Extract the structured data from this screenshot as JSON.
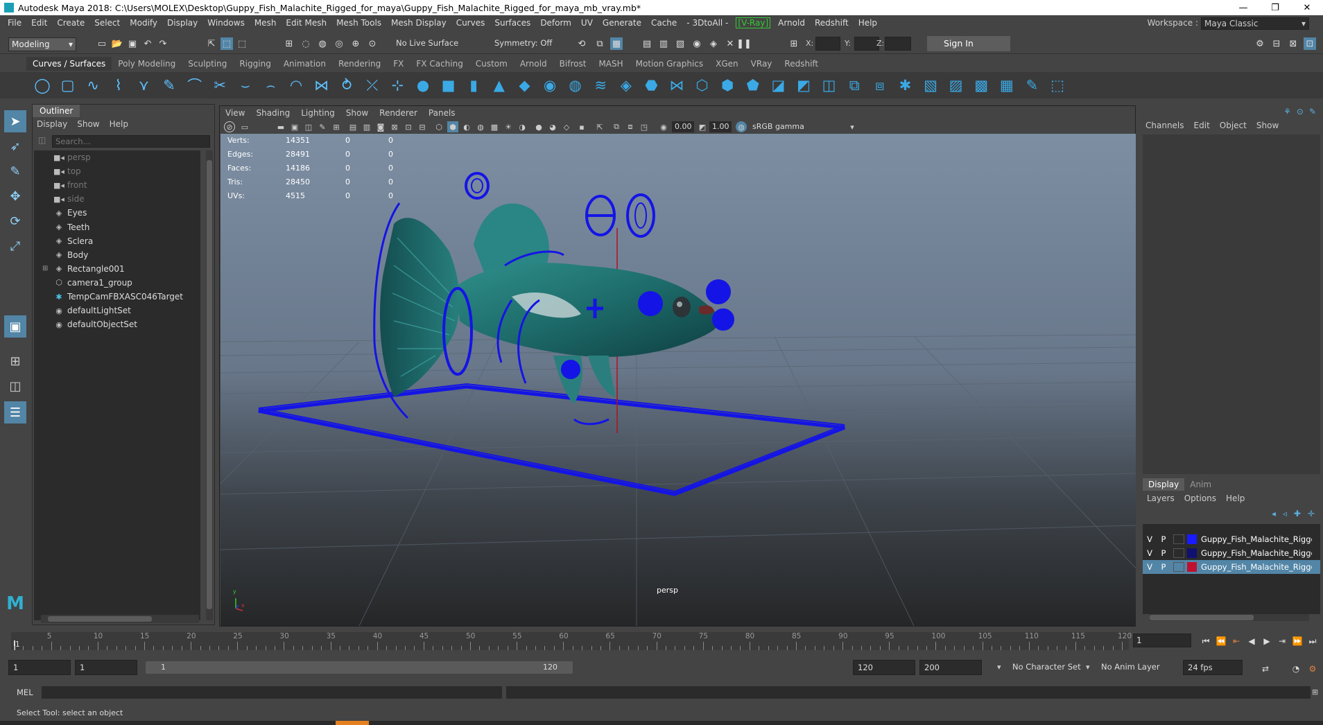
{
  "window": {
    "title": "Autodesk Maya 2018: C:\\Users\\MOLEX\\Desktop\\Guppy_Fish_Malachite_Rigged_for_maya\\Guppy_Fish_Malachite_Rigged_for_maya_mb_vray.mb*",
    "minimize": "—",
    "restore": "❐",
    "close": "✕"
  },
  "menubar": {
    "items": [
      "File",
      "Edit",
      "Create",
      "Select",
      "Modify",
      "Display",
      "Windows",
      "Mesh",
      "Edit Mesh",
      "Mesh Tools",
      "Mesh Display",
      "Curves",
      "Surfaces",
      "Deform",
      "UV",
      "Generate",
      "Cache",
      "- 3DtoAll -",
      "[V-Ray]",
      "Arnold",
      "Redshift",
      "Help"
    ],
    "workspace_label": "Workspace :",
    "workspace_value": "Maya Classic"
  },
  "statusline": {
    "mode": "Modeling",
    "live_surface": "No Live Surface",
    "symmetry": "Symmetry: Off",
    "x_label": "X:",
    "y_label": "Y:",
    "z_label": "Z:",
    "sign_in": "Sign In"
  },
  "shelf": {
    "tabs": [
      "Curves / Surfaces",
      "Poly Modeling",
      "Sculpting",
      "Rigging",
      "Animation",
      "Rendering",
      "FX",
      "FX Caching",
      "Custom",
      "Arnold",
      "Bifrost",
      "MASH",
      "Motion Graphics",
      "XGen",
      "VRay",
      "Redshift"
    ],
    "active_tab": "Curves / Surfaces"
  },
  "outliner": {
    "title": "Outliner",
    "menu": [
      "Display",
      "Show",
      "Help"
    ],
    "search_placeholder": "Search...",
    "items": [
      {
        "label": "persp",
        "icon": "camera-icon",
        "dim": true
      },
      {
        "label": "top",
        "icon": "camera-icon",
        "dim": true
      },
      {
        "label": "front",
        "icon": "camera-icon",
        "dim": true
      },
      {
        "label": "side",
        "icon": "camera-icon",
        "dim": true
      },
      {
        "label": "Eyes",
        "icon": "mesh-icon",
        "dim": false
      },
      {
        "label": "Teeth",
        "icon": "mesh-icon",
        "dim": false
      },
      {
        "label": "Sclera",
        "icon": "mesh-icon",
        "dim": false
      },
      {
        "label": "Body",
        "icon": "mesh-icon",
        "dim": false
      },
      {
        "label": "Rectangle001",
        "icon": "mesh-icon",
        "dim": false,
        "expandable": true
      },
      {
        "label": "camera1_group",
        "icon": "group-icon",
        "dim": false
      },
      {
        "label": "TempCamFBXASC046Target",
        "icon": "locator-icon",
        "dim": false
      },
      {
        "label": "defaultLightSet",
        "icon": "set-icon",
        "dim": false
      },
      {
        "label": "defaultObjectSet",
        "icon": "set-icon",
        "dim": false
      }
    ]
  },
  "viewport": {
    "menu": [
      "View",
      "Shading",
      "Lighting",
      "Show",
      "Renderer",
      "Panels"
    ],
    "exposure": "0.00",
    "gamma": "1.00",
    "color_space": "sRGB gamma",
    "camera_label": "persp",
    "hud": [
      {
        "label": "Verts:",
        "v1": "14351",
        "v2": "0",
        "v3": "0"
      },
      {
        "label": "Edges:",
        "v1": "28491",
        "v2": "0",
        "v3": "0"
      },
      {
        "label": "Faces:",
        "v1": "14186",
        "v2": "0",
        "v3": "0"
      },
      {
        "label": "Tris:",
        "v1": "28450",
        "v2": "0",
        "v3": "0"
      },
      {
        "label": "UVs:",
        "v1": "4515",
        "v2": "0",
        "v3": "0"
      }
    ],
    "axis_y": "y",
    "axis_x": "x"
  },
  "channelbox": {
    "menu": [
      "Channels",
      "Edit",
      "Object",
      "Show"
    ]
  },
  "layers": {
    "tabs": [
      "Display",
      "Anim"
    ],
    "active_tab": "Display",
    "menu": [
      "Layers",
      "Options",
      "Help"
    ],
    "rows": [
      {
        "v": "V",
        "p": "P",
        "name": "Guppy_Fish_Malachite_Rigged",
        "color": "#1a1aff",
        "selected": false
      },
      {
        "v": "V",
        "p": "P",
        "name": "Guppy_Fish_Malachite_Rigged",
        "color": "#101070",
        "selected": false
      },
      {
        "v": "V",
        "p": "P",
        "name": "Guppy_Fish_Malachite_Rigged",
        "color": "#c01030",
        "selected": true
      }
    ]
  },
  "timeslider": {
    "ticks": [
      "5",
      "10",
      "15",
      "20",
      "25",
      "30",
      "35",
      "40",
      "45",
      "50",
      "55",
      "60",
      "65",
      "70",
      "75",
      "80",
      "85",
      "90",
      "95",
      "100",
      "105",
      "110",
      "115",
      "120"
    ],
    "start_label": "1",
    "current_frame": "1"
  },
  "range": {
    "start": "1",
    "playback_start": "1",
    "slider_start": "1",
    "slider_end": "120",
    "playback_end": "120",
    "end": "200",
    "character_set": "No Character Set",
    "anim_layer": "No Anim Layer",
    "fps": "24 fps"
  },
  "commandline": {
    "label": "MEL"
  },
  "helpline": {
    "text": "Select Tool: select an object"
  }
}
